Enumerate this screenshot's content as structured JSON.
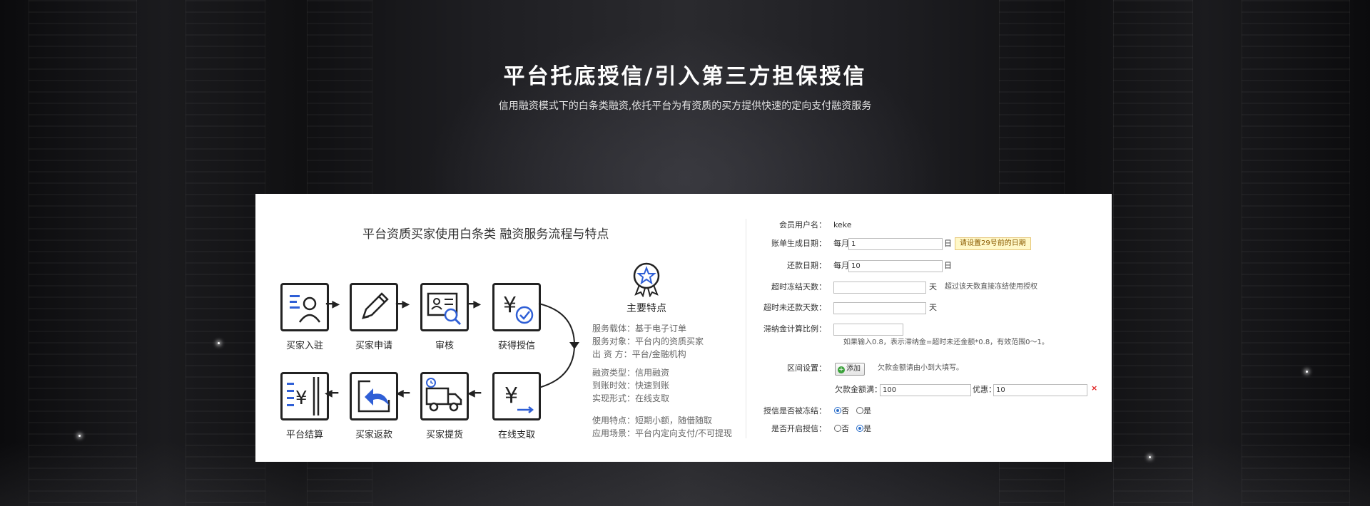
{
  "hero": {
    "title": "平台托底授信/引入第三方担保授信",
    "subtitle": "信用融资模式下的白条类融资,依托平台为有资质的买方提供快速的定向支付融资服务"
  },
  "flow": {
    "title": "平台资质买家使用白条类 融资服务流程与特点",
    "steps_top": [
      {
        "label": "买家入驻",
        "icon": "user-register-icon"
      },
      {
        "label": "买家申请",
        "icon": "pen-icon"
      },
      {
        "label": "审核",
        "icon": "id-card-search-icon"
      },
      {
        "label": "获得授信",
        "icon": "yuan-check-icon"
      }
    ],
    "steps_bottom": [
      {
        "label": "平台结算",
        "icon": "yuan-ledger-icon"
      },
      {
        "label": "买家返款",
        "icon": "return-arrow-icon"
      },
      {
        "label": "买家提货",
        "icon": "delivery-truck-icon"
      },
      {
        "label": "在线支取",
        "icon": "yuan-withdraw-icon"
      }
    ]
  },
  "features": {
    "title": "主要特点",
    "badge_icon": "star-medal-icon",
    "groups": [
      [
        "服务载体：基于电子订单",
        "服务对象：平台内的资质买家",
        "出 资 方：平台/金融机构"
      ],
      [
        "融资类型：信用融资",
        "到账时效：快速到账",
        "实现形式：在线支取"
      ],
      [
        "使用特点：短期小额，随借随取",
        "应用场景：平台内定向支付/不可提现"
      ]
    ]
  },
  "form": {
    "member_label": "会员用户名：",
    "member_value": "keke",
    "bill_date_label": "账单生成日期：",
    "bill_prefix": "每月",
    "bill_value": "1",
    "bill_suffix": "日",
    "bill_tip": "请设置29号前的日期",
    "repay_label": "还款日期：",
    "repay_prefix": "每月",
    "repay_value": "10",
    "repay_suffix": "日",
    "freeze_label": "超时冻结天数：",
    "freeze_value": "",
    "freeze_unit": "天",
    "freeze_tip": "超过该天数直接冻结使用授权",
    "unpaid_label": "超时未还款天数：",
    "unpaid_value": "",
    "unpaid_unit": "天",
    "penalty_label": "滞纳金计算比例：",
    "penalty_value": "",
    "penalty_tip": "如果输入0.8，表示滞纳金=超时未还金额*0.8，有效范围0～1。",
    "range_label": "区间设置：",
    "add_button": "添加",
    "range_tip": "欠款金额请由小到大填写。",
    "debt_label": "欠款金额满：",
    "debt_value": "100",
    "discount_label": "优惠：",
    "discount_value": "10",
    "delete_mark": "×",
    "frozen_label": "授信是否被冻结：",
    "frozen_no": "否",
    "frozen_yes": "是",
    "enable_label": "是否开启授信：",
    "enable_no": "否",
    "enable_yes": "是"
  },
  "colors": {
    "accent_blue": "#2f5fd6",
    "delete_red": "#e02020"
  }
}
